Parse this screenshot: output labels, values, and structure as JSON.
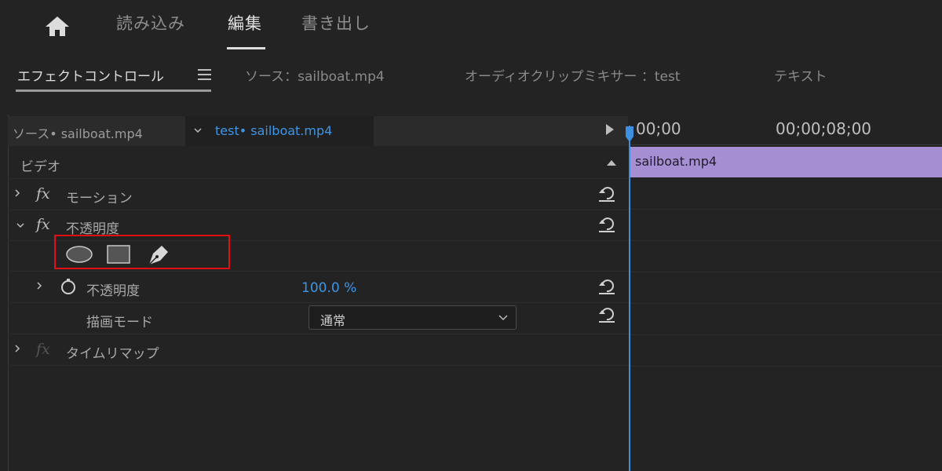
{
  "workspace": {
    "tabs": [
      {
        "label": "読み込み"
      },
      {
        "label": "編集"
      },
      {
        "label": "書き出し"
      }
    ],
    "active_tab": "編集",
    "home_icon": "home-icon"
  },
  "panel_tabs": {
    "effect_controls": "エフェクトコントロール",
    "source": "ソース：sailboat.mp4",
    "audio_mixer": "オーディオクリップミキサー ：test",
    "text": "テキスト"
  },
  "clip_header": {
    "source_label": "ソース• sailboat.mp4",
    "sequence_label": "test• sailboat.mp4"
  },
  "effects": {
    "section_video": "ビデオ",
    "motion": "モーション",
    "opacity": "不透明度",
    "opacity_property": "不透明度",
    "opacity_value": "100.0 %",
    "blend_mode_label": "描画モード",
    "blend_mode_value": "通常",
    "time_remap": "タイムリマップ",
    "fx_symbol": "fx",
    "mask_tools": [
      "ellipse-mask-icon",
      "rectangle-mask-icon",
      "pen-mask-icon"
    ]
  },
  "timeline": {
    "timecode_start": "00;00",
    "timecode_mark": "00;00;08;00",
    "clip_name": "sailboat.mp4"
  },
  "colors": {
    "accent_blue": "#3d95e6",
    "clip_purple": "#a58fd2",
    "highlight_red": "#e10f14",
    "background": "#232323"
  }
}
